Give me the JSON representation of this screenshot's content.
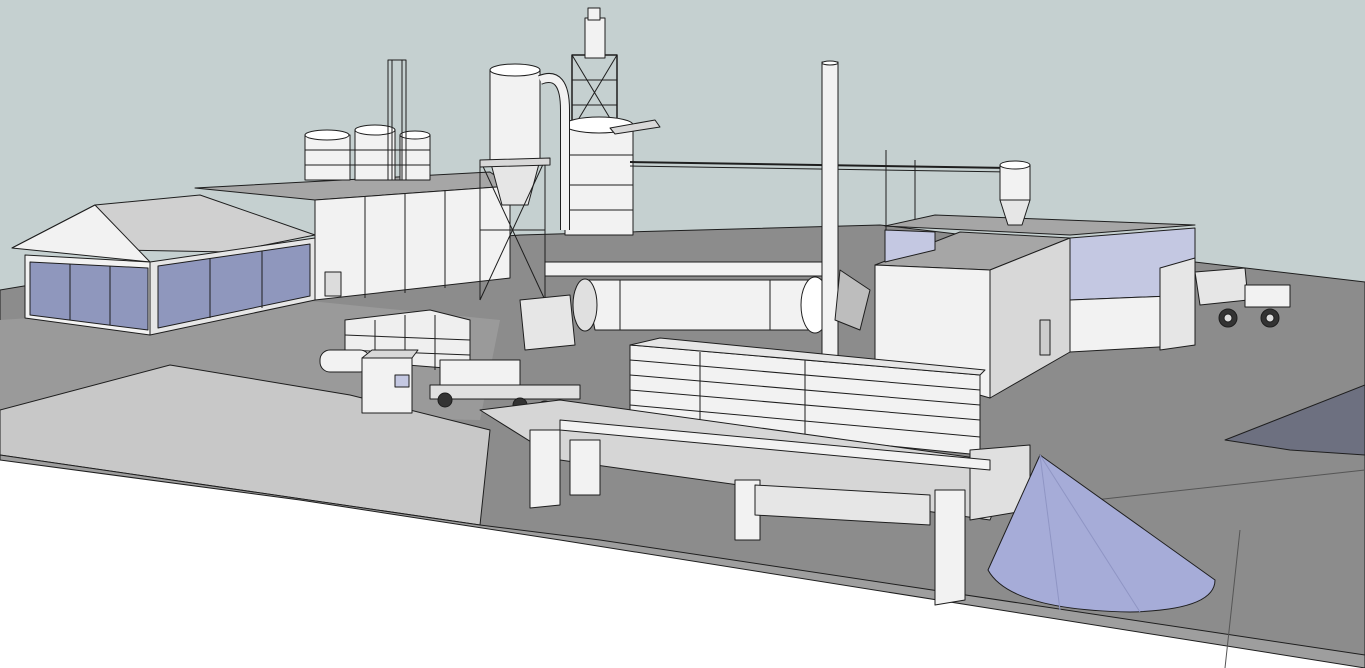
{
  "scene": {
    "kind": "3D model render of industrial plant",
    "colors": {
      "sky": "#c5d0d0",
      "ground_top": "#8c8c8c",
      "ground_mid": "#9e9e9e",
      "ground_light": "#c8c8c8",
      "foreground": "#ffffff",
      "wall_white": "#f2f2f2",
      "wall_shade": "#d8d8d8",
      "roof_grey": "#a6a6a6",
      "window_blue": "#8f97bd",
      "cone_blue": "#a6acd8",
      "outline": "#1e1e1e"
    }
  }
}
